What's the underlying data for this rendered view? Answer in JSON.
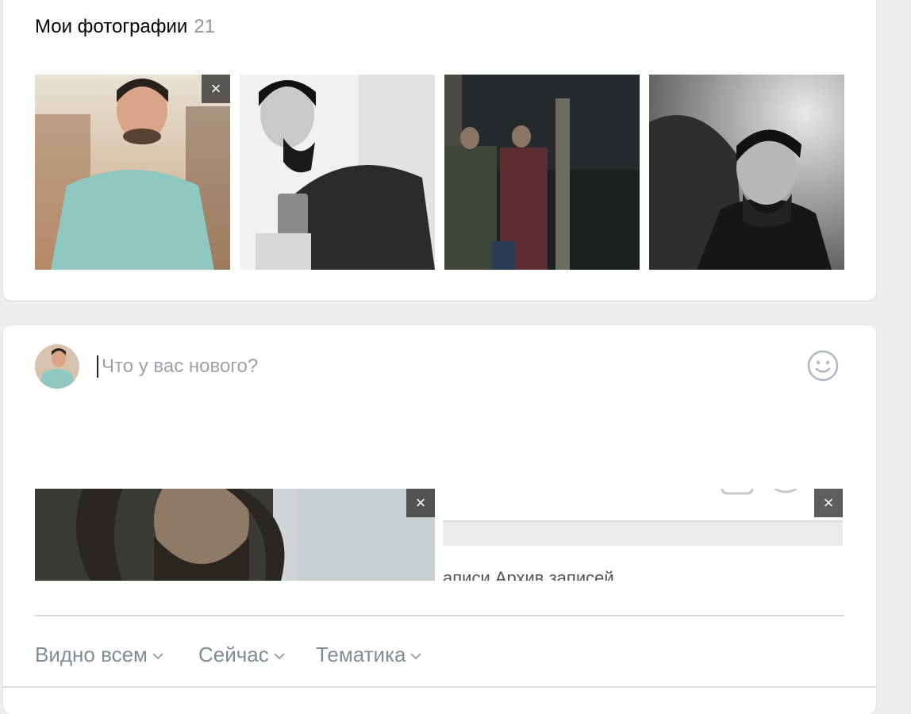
{
  "photos": {
    "title": "Мои фотографии",
    "count": "21",
    "close_label": "×"
  },
  "post": {
    "placeholder": "Что у вас нового?",
    "attachment_text": "аписи   Архив записей",
    "close_label": "×",
    "toolbar": {
      "visibility": "Видно всем",
      "time": "Сейчас",
      "topic": "Тематика"
    }
  },
  "icons": {
    "close": "close-icon",
    "emoji": "smile-icon",
    "chevron": "chevron-down-icon"
  },
  "colors": {
    "page_bg": "#edeef0",
    "card_bg": "#ffffff",
    "placeholder": "#9ea2a8",
    "toolbar_text": "#818c99"
  }
}
